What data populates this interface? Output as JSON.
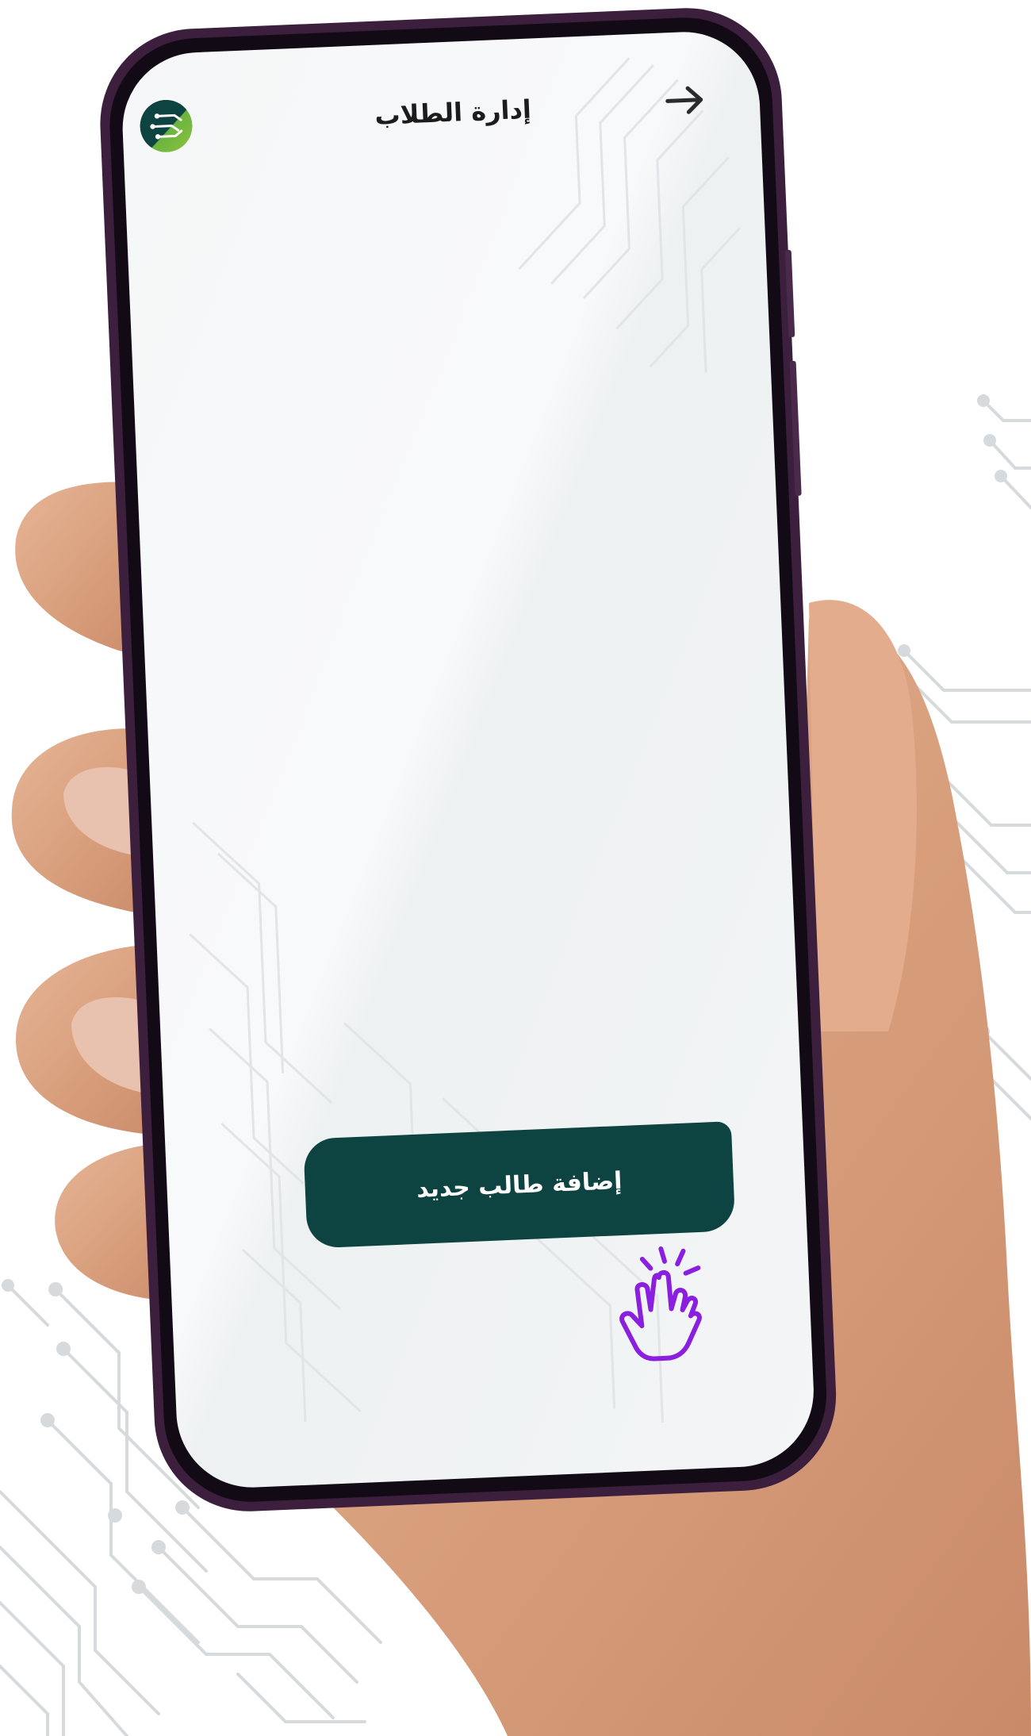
{
  "header": {
    "title": "إدارة الطلاب",
    "back_icon": "arrow-right-icon",
    "logo_icon": "circuit-logo-icon"
  },
  "main": {
    "add_student_button_label": "إضافة طالب جديد",
    "tap_cursor_icon": "hand-pointer-click-icon"
  },
  "colors": {
    "button_bg": "#0d4340",
    "cursor": "#8a1fe0",
    "screen_bg": "#f4f6f7",
    "logo_green": "#6bb33f",
    "logo_dark": "#0d4340"
  }
}
